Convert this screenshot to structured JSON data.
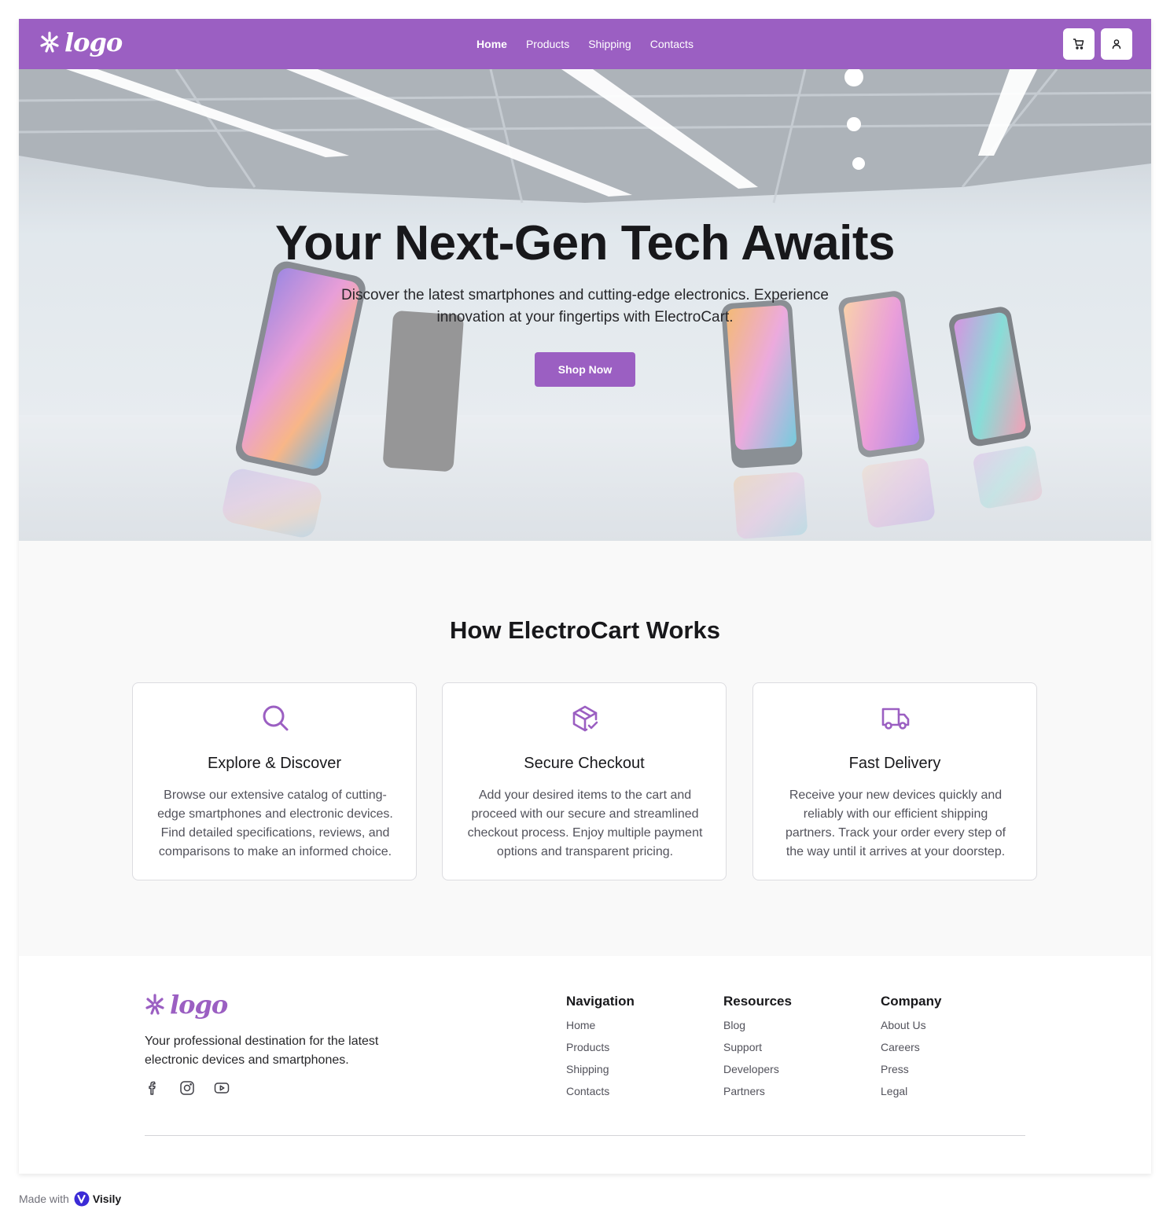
{
  "header": {
    "logo_text": "logo",
    "nav": [
      {
        "label": "Home",
        "active": true
      },
      {
        "label": "Products"
      },
      {
        "label": "Shipping"
      },
      {
        "label": "Contacts"
      }
    ],
    "cart_icon": "cart-icon",
    "user_icon": "user-icon"
  },
  "hero": {
    "title": "Your Next-Gen Tech Awaits",
    "subtitle": "Discover the latest smartphones and cutting-edge electronics. Experience innovation at your fingertips with ElectroCart.",
    "cta": "Shop Now"
  },
  "how": {
    "title": "How ElectroCart Works",
    "cards": [
      {
        "icon": "search-icon",
        "title": "Explore & Discover",
        "text": "Browse our extensive catalog of cutting-edge smartphones and electronic devices. Find detailed specifications, reviews, and comparisons to make an informed choice."
      },
      {
        "icon": "package-check-icon",
        "title": "Secure Checkout",
        "text": "Add your desired items to the cart and proceed with our secure and streamlined checkout process. Enjoy multiple payment options and transparent pricing."
      },
      {
        "icon": "truck-icon",
        "title": "Fast Delivery",
        "text": "Receive your new devices quickly and reliably with our efficient shipping partners. Track your order every step of the way until it arrives at your doorstep."
      }
    ]
  },
  "footer": {
    "logo_text": "logo",
    "description": "Your professional destination for the latest electronic devices and smartphones.",
    "socials": [
      "facebook-icon",
      "instagram-icon",
      "youtube-icon"
    ],
    "columns": [
      {
        "title": "Navigation",
        "links": [
          "Home",
          "Products",
          "Shipping",
          "Contacts"
        ]
      },
      {
        "title": "Resources",
        "links": [
          "Blog",
          "Support",
          "Developers",
          "Partners"
        ]
      },
      {
        "title": "Company",
        "links": [
          "About Us",
          "Careers",
          "Press",
          "Legal"
        ]
      }
    ]
  },
  "made_with": {
    "prefix": "Made with",
    "brand": "Visily"
  },
  "colors": {
    "accent": "#9b5fc2",
    "text": "#18181b",
    "muted": "#52525b",
    "section_bg": "#f9f9f9"
  }
}
